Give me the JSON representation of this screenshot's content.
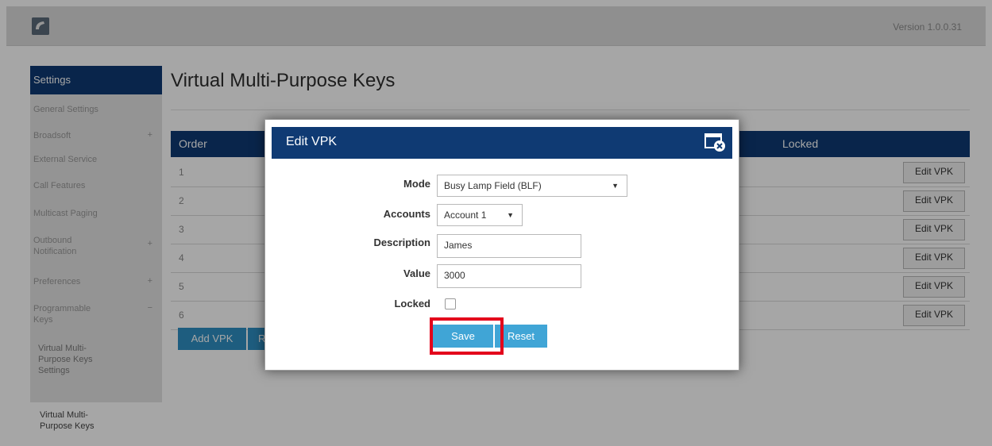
{
  "app": {
    "version": "Version 1.0.0.31"
  },
  "sidebar": {
    "header": "Settings",
    "items": [
      {
        "label": "General Settings",
        "icon": ""
      },
      {
        "label": "Broadsoft",
        "icon": "+"
      },
      {
        "label": "External Service",
        "icon": ""
      },
      {
        "label": "Call Features",
        "icon": ""
      },
      {
        "label": "Multicast Paging",
        "icon": ""
      },
      {
        "label": "Outbound Notification",
        "icon": "+"
      },
      {
        "label": "Preferences",
        "icon": "+"
      },
      {
        "label": "Programmable Keys",
        "icon": "−"
      }
    ],
    "sub_item": "Virtual Multi-Purpose Keys Settings",
    "bottom_item": "Virtual Multi-Purpose Keys"
  },
  "page": {
    "title": "Virtual Multi-Purpose Keys"
  },
  "table": {
    "headers": {
      "order": "Order",
      "locked": "Locked"
    },
    "rows": [
      {
        "order": "1",
        "action": "Edit VPK"
      },
      {
        "order": "2",
        "action": "Edit VPK"
      },
      {
        "order": "3",
        "action": "Edit VPK"
      },
      {
        "order": "4",
        "action": "Edit VPK"
      },
      {
        "order": "5",
        "action": "Edit VPK"
      },
      {
        "order": "6",
        "action": "Edit VPK"
      }
    ],
    "add_button": "Add VPK",
    "second_button_initial": "R"
  },
  "modal": {
    "title": "Edit VPK",
    "fields": {
      "mode": {
        "label": "Mode",
        "value": "Busy Lamp Field (BLF)"
      },
      "accounts": {
        "label": "Accounts",
        "value": "Account 1"
      },
      "description": {
        "label": "Description",
        "value": "James"
      },
      "value": {
        "label": "Value",
        "value": "3000"
      },
      "locked": {
        "label": "Locked",
        "checked": false
      }
    },
    "save": "Save",
    "reset": "Reset"
  },
  "colors": {
    "navy": "#0f3a73",
    "button_blue": "#40a5d6",
    "highlight": "#e3001b"
  }
}
